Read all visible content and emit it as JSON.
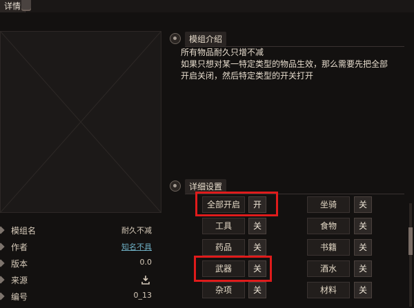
{
  "header": {
    "tab_title": "详情"
  },
  "info": {
    "rows": [
      {
        "key": "模组名",
        "value": "耐久不减"
      },
      {
        "key": "作者",
        "value": "知名不具"
      },
      {
        "key": "版本",
        "value": "0.0"
      },
      {
        "key": "来源",
        "value": ""
      },
      {
        "key": "编号",
        "value": "0_13"
      }
    ]
  },
  "intro": {
    "title": "模组介绍",
    "lines": [
      "所有物品耐久只增不减",
      "如果只想对某一特定类型的物品生效，那么需要先把全部",
      "开启关闭，然后特定类型的开关打开"
    ]
  },
  "settings": {
    "title": "详细设置",
    "left": [
      {
        "label": "全部开启",
        "value": "开"
      },
      {
        "label": "工具",
        "value": "关"
      },
      {
        "label": "药品",
        "value": "关"
      },
      {
        "label": "武器",
        "value": "关"
      },
      {
        "label": "杂项",
        "value": "关"
      }
    ],
    "right": [
      {
        "label": "坐骑",
        "value": "关"
      },
      {
        "label": "食物",
        "value": "关"
      },
      {
        "label": "书籍",
        "value": "关"
      },
      {
        "label": "酒水",
        "value": "关"
      },
      {
        "label": "材料",
        "value": "关"
      }
    ]
  },
  "icons": {
    "source": "download-icon"
  },
  "colors": {
    "highlight": "#e01b1b",
    "link": "#6fb1c6"
  }
}
